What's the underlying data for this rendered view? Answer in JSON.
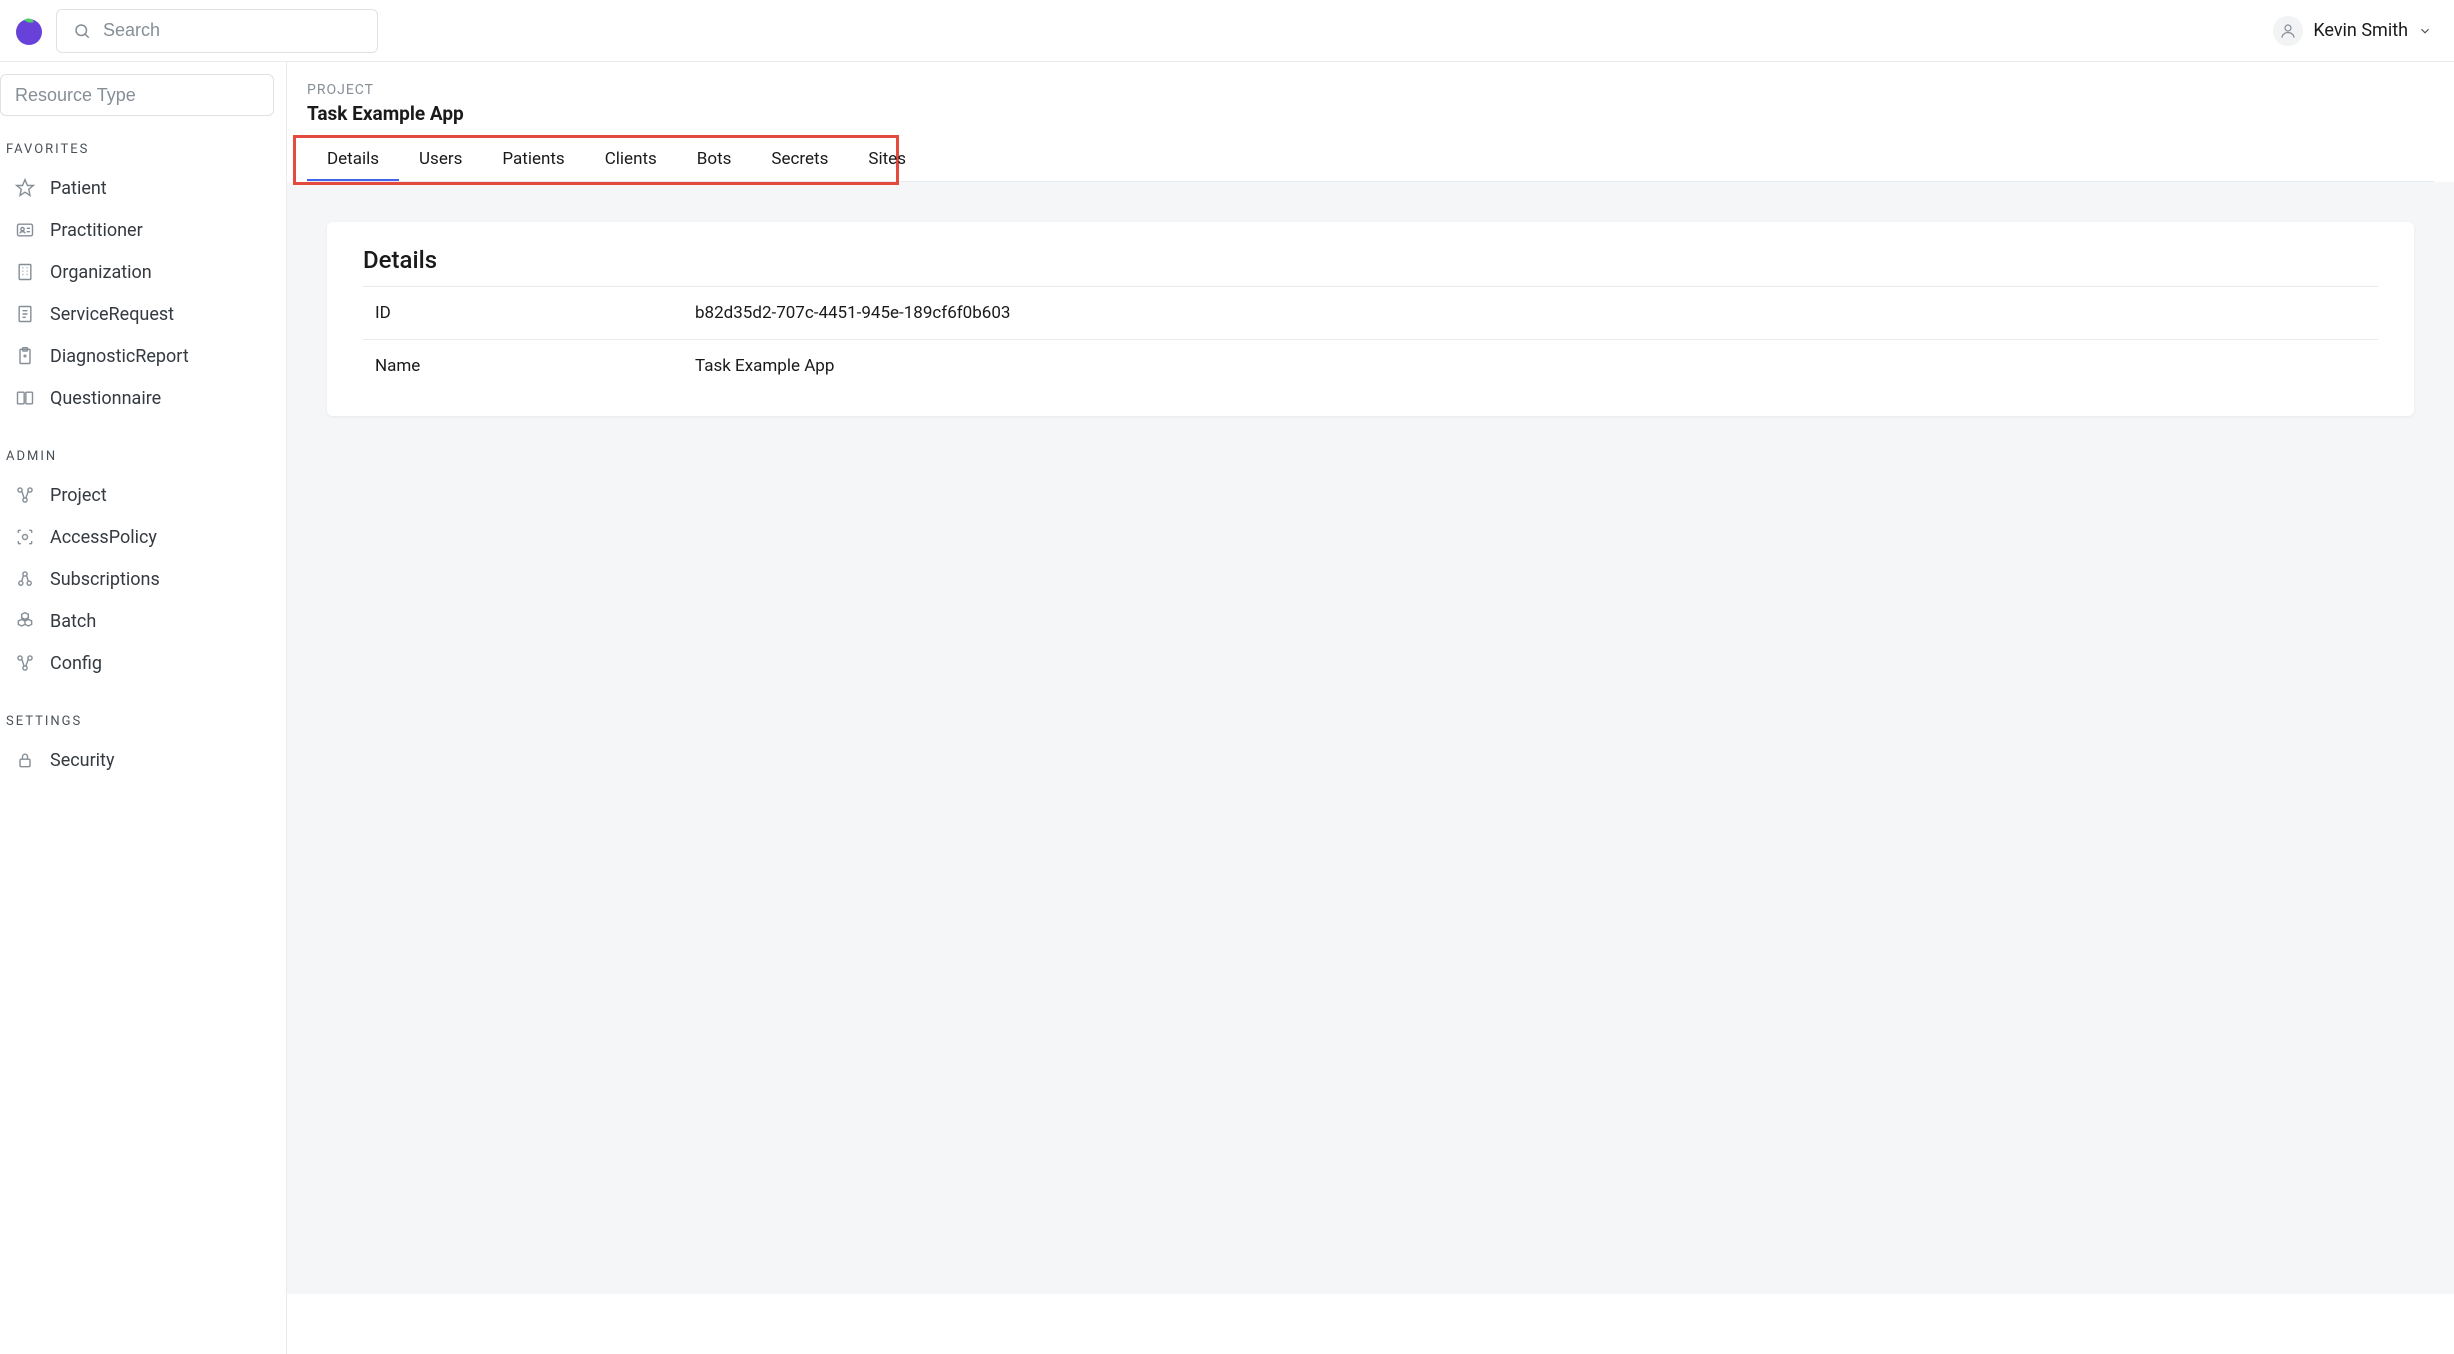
{
  "topbar": {
    "search_placeholder": "Search",
    "user_name": "Kevin Smith"
  },
  "sidebar": {
    "resource_type_placeholder": "Resource Type",
    "sections": {
      "favorites": {
        "label": "Favorites",
        "items": [
          {
            "label": "Patient",
            "icon": "star-icon"
          },
          {
            "label": "Practitioner",
            "icon": "id-card-icon"
          },
          {
            "label": "Organization",
            "icon": "building-icon"
          },
          {
            "label": "ServiceRequest",
            "icon": "document-icon"
          },
          {
            "label": "DiagnosticReport",
            "icon": "clipboard-icon"
          },
          {
            "label": "Questionnaire",
            "icon": "forms-icon"
          }
        ]
      },
      "admin": {
        "label": "Admin",
        "items": [
          {
            "label": "Project",
            "icon": "nodes-icon"
          },
          {
            "label": "AccessPolicy",
            "icon": "scan-icon"
          },
          {
            "label": "Subscriptions",
            "icon": "webhook-icon"
          },
          {
            "label": "Batch",
            "icon": "hexagons-icon"
          },
          {
            "label": "Config",
            "icon": "nodes-icon"
          }
        ]
      },
      "settings": {
        "label": "Settings",
        "items": [
          {
            "label": "Security",
            "icon": "lock-icon"
          }
        ]
      }
    }
  },
  "page": {
    "breadcrumb": "PROJECT",
    "title": "Task Example App",
    "tabs": [
      {
        "label": "Details",
        "active": true
      },
      {
        "label": "Users",
        "active": false
      },
      {
        "label": "Patients",
        "active": false
      },
      {
        "label": "Clients",
        "active": false
      },
      {
        "label": "Bots",
        "active": false
      },
      {
        "label": "Secrets",
        "active": false
      },
      {
        "label": "Sites",
        "active": false
      }
    ],
    "details_card": {
      "title": "Details",
      "rows": [
        {
          "key": "ID",
          "value": "b82d35d2-707c-4451-945e-189cf6f0b603"
        },
        {
          "key": "Name",
          "value": "Task Example App"
        }
      ]
    }
  }
}
